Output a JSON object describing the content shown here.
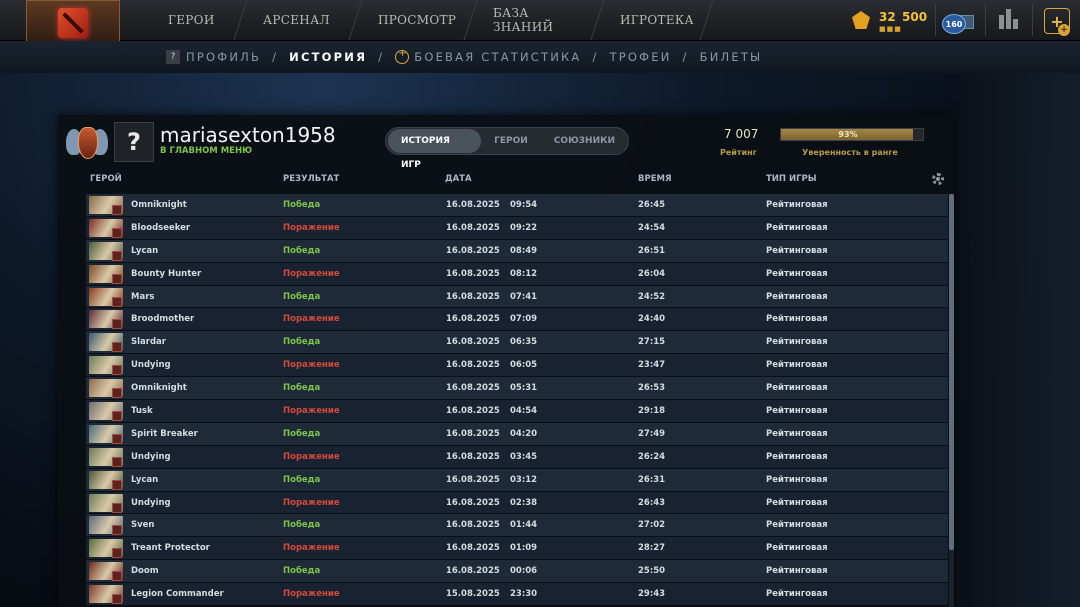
{
  "nav": {
    "items": [
      "ГЕРОИ",
      "АРСЕНАЛ",
      "ПРОСМОТР",
      "БАЗА ЗНАНИЙ",
      "ИГРОТЕКА"
    ]
  },
  "topbar": {
    "shards_value": "32",
    "shards_sub": "■■■",
    "currency_value": "500",
    "level": "160"
  },
  "subnav": {
    "profile_badge": "?",
    "items": [
      "ПРОФИЛЬ",
      "ИСТОРИЯ",
      "БОЕВАЯ СТАТИСТИКА",
      "ТРОФЕИ",
      "БИЛЕТЫ"
    ],
    "separator": "/",
    "active": "ИСТОРИЯ"
  },
  "profile": {
    "avatar_placeholder": "?",
    "username": "mariasexton1958",
    "status": "В ГЛАВНОМ МЕНЮ",
    "rating_value": "7 007",
    "rating_label": "Рейтинг",
    "confidence_percent": 93,
    "confidence_text": "93%",
    "confidence_label": "Уверенность в ранге"
  },
  "tabs": [
    "ИСТОРИЯ ИГР",
    "ГЕРОИ",
    "СОЮЗНИКИ"
  ],
  "table": {
    "headers": [
      "ГЕРОЙ",
      "РЕЗУЛЬТАТ",
      "ДАТА",
      "ВРЕМЯ",
      "ТИП ИГРЫ"
    ],
    "rows": [
      {
        "hero": "Omniknight",
        "result": "Победа",
        "win": true,
        "date": "16.08.2025",
        "time": "09:54",
        "duration": "26:45",
        "type": "Рейтинговая"
      },
      {
        "hero": "Bloodseeker",
        "result": "Поражение",
        "win": false,
        "date": "16.08.2025",
        "time": "09:22",
        "duration": "24:54",
        "type": "Рейтинговая"
      },
      {
        "hero": "Lycan",
        "result": "Победа",
        "win": true,
        "date": "16.08.2025",
        "time": "08:49",
        "duration": "26:51",
        "type": "Рейтинговая"
      },
      {
        "hero": "Bounty Hunter",
        "result": "Поражение",
        "win": false,
        "date": "16.08.2025",
        "time": "08:12",
        "duration": "26:04",
        "type": "Рейтинговая"
      },
      {
        "hero": "Mars",
        "result": "Победа",
        "win": true,
        "date": "16.08.2025",
        "time": "07:41",
        "duration": "24:52",
        "type": "Рейтинговая"
      },
      {
        "hero": "Broodmother",
        "result": "Поражение",
        "win": false,
        "date": "16.08.2025",
        "time": "07:09",
        "duration": "24:40",
        "type": "Рейтинговая"
      },
      {
        "hero": "Slardar",
        "result": "Победа",
        "win": true,
        "date": "16.08.2025",
        "time": "06:35",
        "duration": "27:15",
        "type": "Рейтинговая"
      },
      {
        "hero": "Undying",
        "result": "Поражение",
        "win": false,
        "date": "16.08.2025",
        "time": "06:05",
        "duration": "23:47",
        "type": "Рейтинговая"
      },
      {
        "hero": "Omniknight",
        "result": "Победа",
        "win": true,
        "date": "16.08.2025",
        "time": "05:31",
        "duration": "26:53",
        "type": "Рейтинговая"
      },
      {
        "hero": "Tusk",
        "result": "Поражение",
        "win": false,
        "date": "16.08.2025",
        "time": "04:54",
        "duration": "29:18",
        "type": "Рейтинговая"
      },
      {
        "hero": "Spirit Breaker",
        "result": "Победа",
        "win": true,
        "date": "16.08.2025",
        "time": "04:20",
        "duration": "27:49",
        "type": "Рейтинговая"
      },
      {
        "hero": "Undying",
        "result": "Поражение",
        "win": false,
        "date": "16.08.2025",
        "time": "03:45",
        "duration": "26:24",
        "type": "Рейтинговая"
      },
      {
        "hero": "Lycan",
        "result": "Победа",
        "win": true,
        "date": "16.08.2025",
        "time": "03:12",
        "duration": "26:31",
        "type": "Рейтинговая"
      },
      {
        "hero": "Undying",
        "result": "Поражение",
        "win": false,
        "date": "16.08.2025",
        "time": "02:38",
        "duration": "26:43",
        "type": "Рейтинговая"
      },
      {
        "hero": "Sven",
        "result": "Победа",
        "win": true,
        "date": "16.08.2025",
        "time": "01:44",
        "duration": "27:02",
        "type": "Рейтинговая"
      },
      {
        "hero": "Treant Protector",
        "result": "Поражение",
        "win": false,
        "date": "16.08.2025",
        "time": "01:09",
        "duration": "28:27",
        "type": "Рейтинговая"
      },
      {
        "hero": "Doom",
        "result": "Победа",
        "win": true,
        "date": "16.08.2025",
        "time": "00:06",
        "duration": "25:50",
        "type": "Рейтинговая"
      },
      {
        "hero": "Legion Commander",
        "result": "Поражение",
        "win": false,
        "date": "15.08.2025",
        "time": "23:30",
        "duration": "29:43",
        "type": "Рейтинговая"
      }
    ]
  },
  "colors": {
    "win": "#7cc548",
    "loss": "#d34a3b",
    "gold": "#b79a4a"
  }
}
